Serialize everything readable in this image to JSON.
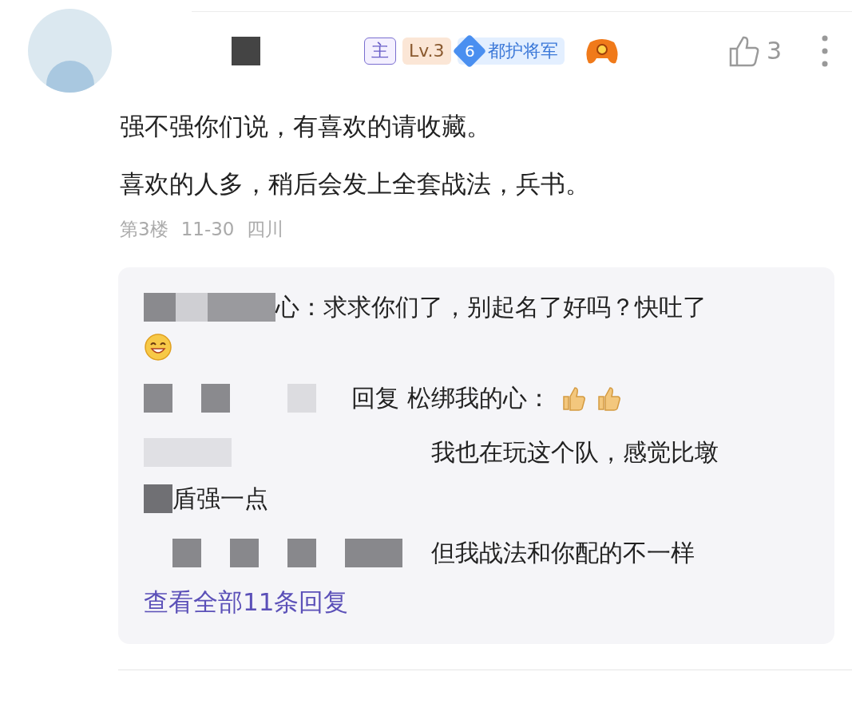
{
  "post": {
    "badges": [
      {
        "kind": "role",
        "text": "主"
      },
      {
        "kind": "level",
        "text": "Lv.3"
      },
      {
        "kind": "rank",
        "number": "6",
        "text": "都护将军"
      }
    ],
    "likes": "3",
    "content": [
      "强不强你们说，有喜欢的请收藏。",
      "喜欢的人多，稍后会发上全套战法，兵书。"
    ],
    "meta": [
      "第3楼",
      "11-30",
      "四川"
    ]
  },
  "replies": [
    {
      "text": "心：求求你们了，别起名了好吗？快吐了",
      "emojis": [
        {
          "kind": "grin"
        }
      ]
    },
    {
      "text": "回复 松绑我的心：",
      "emojis": [
        {
          "kind": "thumb"
        },
        {
          "kind": "thumb"
        }
      ]
    },
    {
      "text": "我也在玩这个队，感觉比墩",
      "continuation": "盾强一点"
    },
    {
      "text": "但我战法和你配的不一样"
    }
  ],
  "more_link": "查看全部11条回复"
}
